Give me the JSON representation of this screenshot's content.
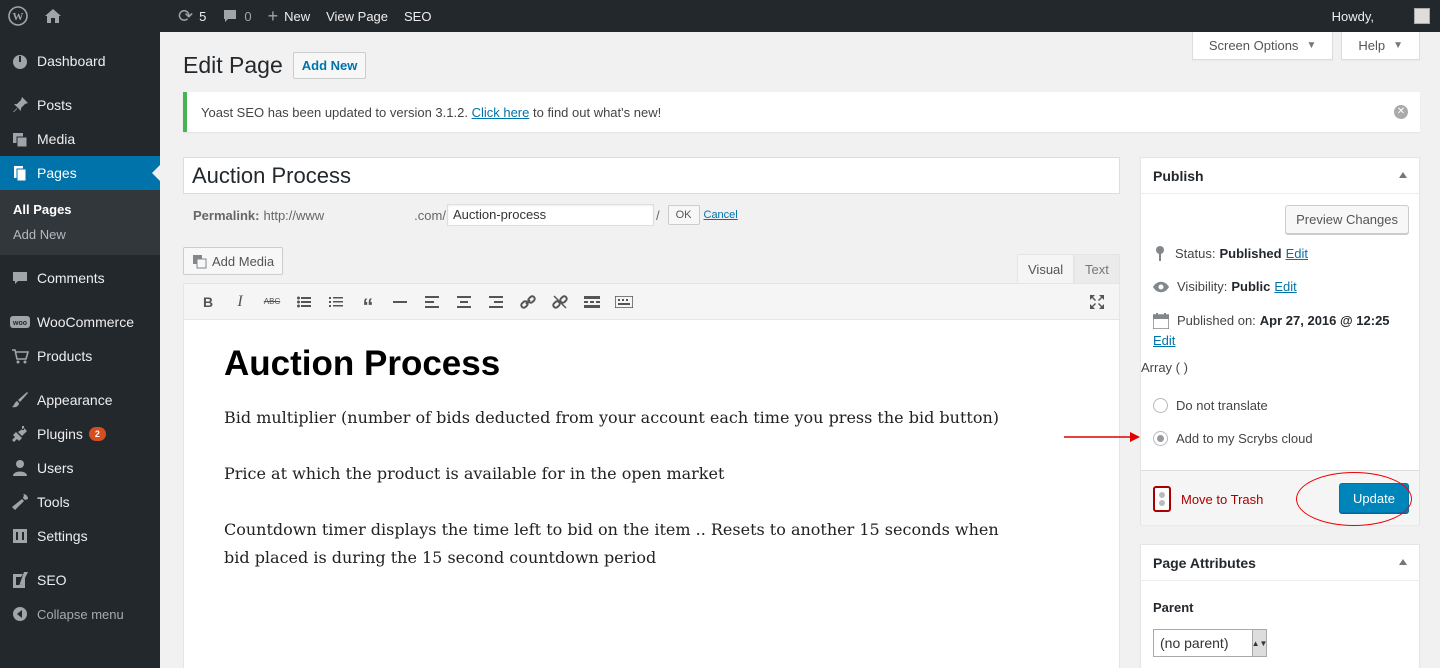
{
  "adminbar": {
    "updates_count": "5",
    "comments_count": "0",
    "new_label": "New",
    "view_page_label": "View Page",
    "seo_label": "SEO",
    "howdy": "Howdy,"
  },
  "sidebar": {
    "dashboard": "Dashboard",
    "posts": "Posts",
    "media": "Media",
    "pages": "Pages",
    "all_pages": "All Pages",
    "add_new": "Add New",
    "comments": "Comments",
    "woocommerce": "WooCommerce",
    "products": "Products",
    "appearance": "Appearance",
    "plugins": "Plugins",
    "plugins_badge": "2",
    "users": "Users",
    "tools": "Tools",
    "settings": "Settings",
    "seo": "SEO",
    "collapse": "Collapse menu"
  },
  "screen_meta": {
    "screen_options": "Screen Options",
    "help": "Help"
  },
  "header": {
    "title": "Edit Page",
    "add_new": "Add New"
  },
  "notice": {
    "text_before": "Yoast SEO has been updated to version 3.1.2.",
    "link": "Click here",
    "text_after": "to find out what's new!"
  },
  "post": {
    "title": "Auction Process",
    "permalink_label": "Permalink:",
    "permalink_prefix": "http://www",
    "permalink_suffix": ".com/",
    "slug": "Auction-process",
    "slash": "/",
    "ok": "OK",
    "cancel": "Cancel"
  },
  "editor": {
    "add_media": "Add Media",
    "tab_visual": "Visual",
    "tab_text": "Text",
    "heading": "Auction Process",
    "paragraphs": [
      "Bid multiplier (number of bids deducted from your account each time you press the bid button)",
      "Price at which the product is available for in the open market",
      "Countdown timer displays the time left to bid on the item .. Resets to another 15 seconds when bid placed is during the 15 second countdown period"
    ]
  },
  "publish": {
    "title": "Publish",
    "preview": "Preview Changes",
    "status_label": "Status:",
    "status_value": "Published",
    "visibility_label": "Visibility:",
    "visibility_value": "Public",
    "published_label": "Published on:",
    "published_value": "Apr 27, 2016 @ 12:25",
    "edit": "Edit",
    "array_text": "Array ( )",
    "radio_1": "Do not translate",
    "radio_2": "Add to my Scrybs cloud",
    "trash": "Move to Trash",
    "update": "Update"
  },
  "page_attributes": {
    "title": "Page Attributes",
    "parent_label": "Parent",
    "parent_value": "(no parent)"
  },
  "colors": {
    "admin_bar": "#23282d",
    "accent": "#0073aa",
    "update_button": "#0085ba",
    "notice_success": "#46b450",
    "annotation_red": "#e00000"
  }
}
